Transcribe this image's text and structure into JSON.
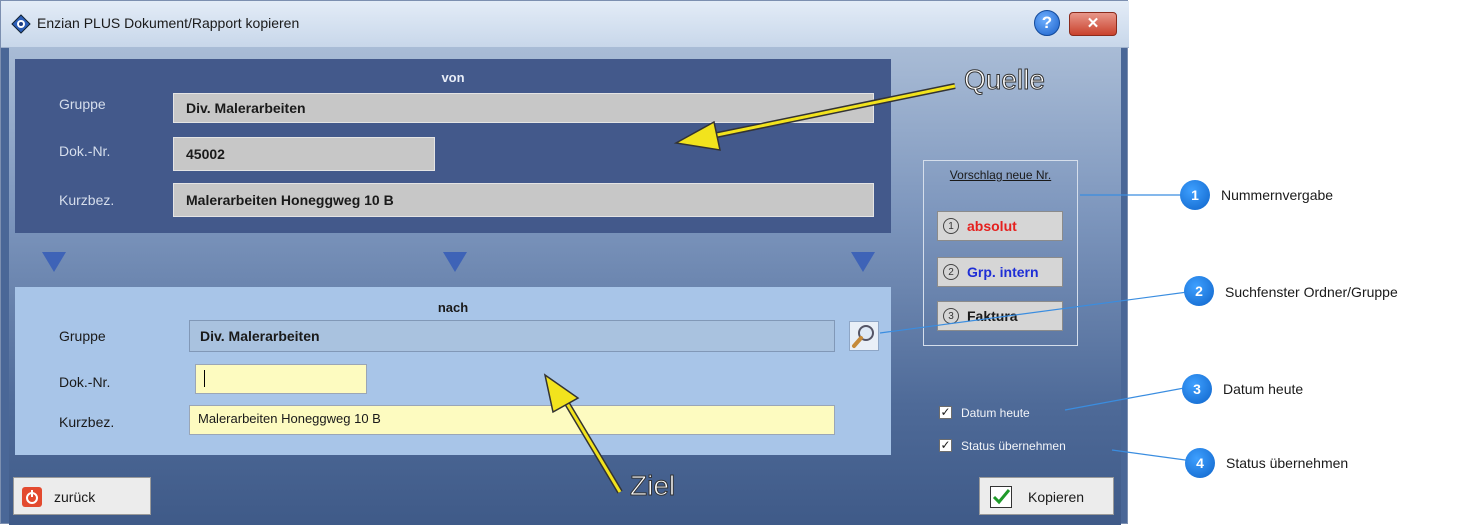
{
  "window": {
    "title": "Enzian PLUS  Dokument/Rapport kopieren",
    "help_glyph": "?",
    "close_glyph": "✕"
  },
  "von": {
    "header": "von",
    "gruppe_label": "Gruppe",
    "gruppe_value": "Div. Malerarbeiten",
    "doknr_label": "Dok.-Nr.",
    "doknr_value": "45002",
    "kurzbez_label": "Kurzbez.",
    "kurzbez_value": "Malerarbeiten Honeggweg 10 B"
  },
  "nach": {
    "header": "nach",
    "gruppe_label": "Gruppe",
    "gruppe_value": "Div. Malerarbeiten",
    "doknr_label": "Dok.-Nr.",
    "doknr_value": "",
    "kurzbez_label": "Kurzbez.",
    "kurzbez_value": "Malerarbeiten Honeggweg 10 B"
  },
  "vorschlag": {
    "label": "Vorschlag neue Nr.",
    "buttons": [
      {
        "num": "1",
        "label": "absolut",
        "color": "#e5201e"
      },
      {
        "num": "2",
        "label": "Grp. intern",
        "color": "#1e2ed6"
      },
      {
        "num": "3",
        "label": "Faktura",
        "color": "#1a1a1a"
      }
    ]
  },
  "options": {
    "datum_heute": {
      "label": "Datum heute",
      "checked": true
    },
    "status_uebernehmen": {
      "label": "Status übernehmen",
      "checked": true
    }
  },
  "footer": {
    "zurueck_label": "zurück",
    "kopieren_label": "Kopieren"
  },
  "annotations": {
    "quelle": "Quelle",
    "ziel": "Ziel",
    "callouts": [
      {
        "num": "1",
        "text": "Nummernvergabe"
      },
      {
        "num": "2",
        "text": "Suchfenster Ordner/Gruppe"
      },
      {
        "num": "3",
        "text": "Datum heute"
      },
      {
        "num": "4",
        "text": "Status übernehmen"
      }
    ]
  },
  "icons": {
    "title": "app-logo-icon",
    "search": "magnifier-icon",
    "zurueck": "power-icon",
    "kopieren": "checkmark-icon"
  }
}
